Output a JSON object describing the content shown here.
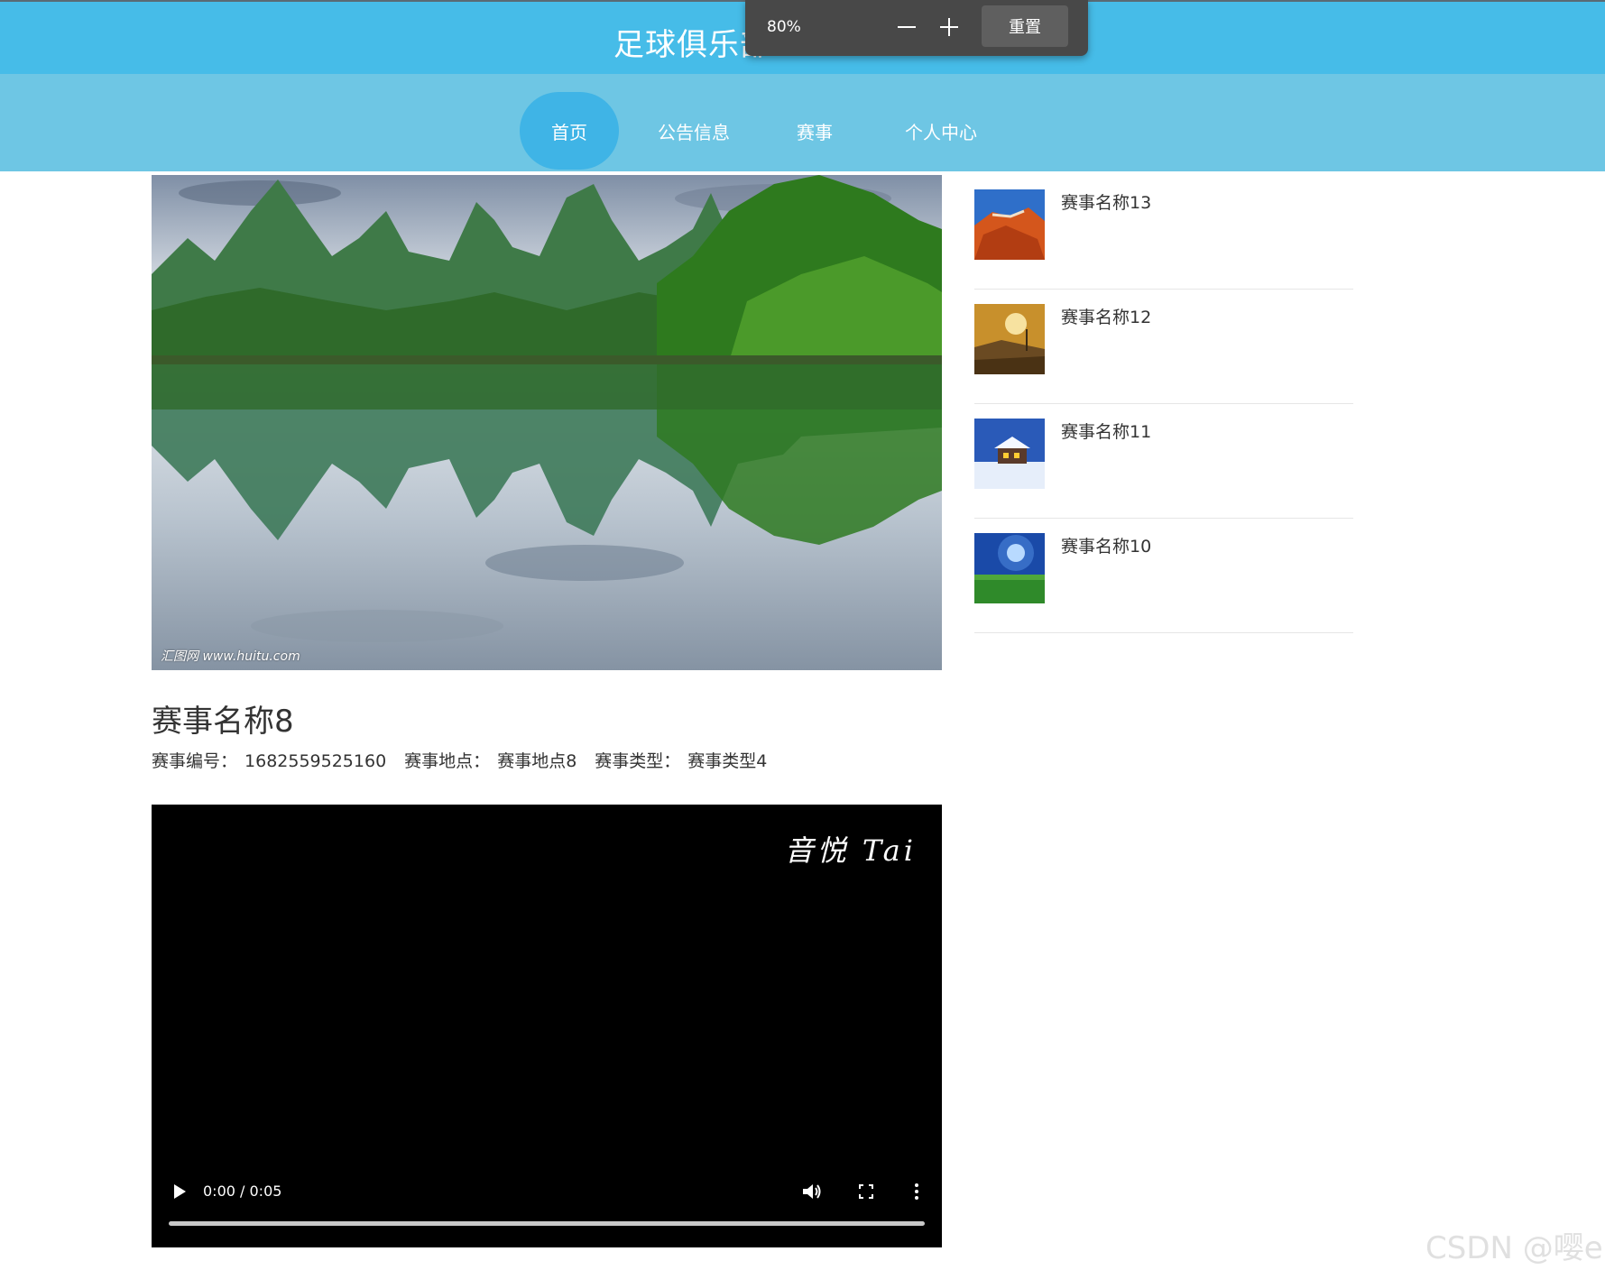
{
  "header": {
    "title": "足球俱乐部"
  },
  "zoom": {
    "level": "80%",
    "reset_label": "重置"
  },
  "nav": {
    "items": [
      "首页",
      "公告信息",
      "赛事",
      "个人中心"
    ],
    "active_index": 0
  },
  "main_image": {
    "watermark": "汇图网 www.huitu.com"
  },
  "detail": {
    "title": "赛事名称8",
    "number_label": "赛事编号：",
    "number": "1682559525160",
    "location_label": "赛事地点：",
    "location": "赛事地点8",
    "type_label": "赛事类型：",
    "type": "赛事类型4"
  },
  "video": {
    "logo": "音悦 Tai",
    "time": "0:00 / 0:05"
  },
  "sidebar": {
    "items": [
      {
        "label": "赛事名称13",
        "thumb": "red-rock-icon"
      },
      {
        "label": "赛事名称12",
        "thumb": "sunset-tree-icon"
      },
      {
        "label": "赛事名称11",
        "thumb": "snow-cabin-icon"
      },
      {
        "label": "赛事名称10",
        "thumb": "blue-sky-field-icon"
      }
    ]
  },
  "page_watermark": "CSDN @嘤er",
  "colors": {
    "topbar": "#46bce8",
    "navbar": "#6ec6e4",
    "nav_active": "#3fb4e6",
    "zoom_popup": "#484848"
  }
}
